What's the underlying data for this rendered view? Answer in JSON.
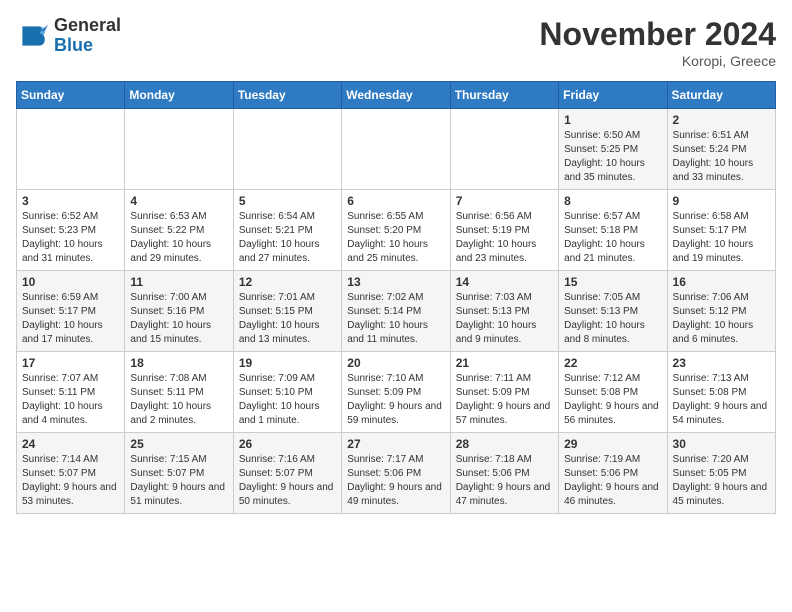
{
  "logo": {
    "general": "General",
    "blue": "Blue"
  },
  "title": "November 2024",
  "location": "Koropi, Greece",
  "days_header": [
    "Sunday",
    "Monday",
    "Tuesday",
    "Wednesday",
    "Thursday",
    "Friday",
    "Saturday"
  ],
  "weeks": [
    [
      {
        "day": "",
        "info": ""
      },
      {
        "day": "",
        "info": ""
      },
      {
        "day": "",
        "info": ""
      },
      {
        "day": "",
        "info": ""
      },
      {
        "day": "",
        "info": ""
      },
      {
        "day": "1",
        "info": "Sunrise: 6:50 AM\nSunset: 5:25 PM\nDaylight: 10 hours and 35 minutes."
      },
      {
        "day": "2",
        "info": "Sunrise: 6:51 AM\nSunset: 5:24 PM\nDaylight: 10 hours and 33 minutes."
      }
    ],
    [
      {
        "day": "3",
        "info": "Sunrise: 6:52 AM\nSunset: 5:23 PM\nDaylight: 10 hours and 31 minutes."
      },
      {
        "day": "4",
        "info": "Sunrise: 6:53 AM\nSunset: 5:22 PM\nDaylight: 10 hours and 29 minutes."
      },
      {
        "day": "5",
        "info": "Sunrise: 6:54 AM\nSunset: 5:21 PM\nDaylight: 10 hours and 27 minutes."
      },
      {
        "day": "6",
        "info": "Sunrise: 6:55 AM\nSunset: 5:20 PM\nDaylight: 10 hours and 25 minutes."
      },
      {
        "day": "7",
        "info": "Sunrise: 6:56 AM\nSunset: 5:19 PM\nDaylight: 10 hours and 23 minutes."
      },
      {
        "day": "8",
        "info": "Sunrise: 6:57 AM\nSunset: 5:18 PM\nDaylight: 10 hours and 21 minutes."
      },
      {
        "day": "9",
        "info": "Sunrise: 6:58 AM\nSunset: 5:17 PM\nDaylight: 10 hours and 19 minutes."
      }
    ],
    [
      {
        "day": "10",
        "info": "Sunrise: 6:59 AM\nSunset: 5:17 PM\nDaylight: 10 hours and 17 minutes."
      },
      {
        "day": "11",
        "info": "Sunrise: 7:00 AM\nSunset: 5:16 PM\nDaylight: 10 hours and 15 minutes."
      },
      {
        "day": "12",
        "info": "Sunrise: 7:01 AM\nSunset: 5:15 PM\nDaylight: 10 hours and 13 minutes."
      },
      {
        "day": "13",
        "info": "Sunrise: 7:02 AM\nSunset: 5:14 PM\nDaylight: 10 hours and 11 minutes."
      },
      {
        "day": "14",
        "info": "Sunrise: 7:03 AM\nSunset: 5:13 PM\nDaylight: 10 hours and 9 minutes."
      },
      {
        "day": "15",
        "info": "Sunrise: 7:05 AM\nSunset: 5:13 PM\nDaylight: 10 hours and 8 minutes."
      },
      {
        "day": "16",
        "info": "Sunrise: 7:06 AM\nSunset: 5:12 PM\nDaylight: 10 hours and 6 minutes."
      }
    ],
    [
      {
        "day": "17",
        "info": "Sunrise: 7:07 AM\nSunset: 5:11 PM\nDaylight: 10 hours and 4 minutes."
      },
      {
        "day": "18",
        "info": "Sunrise: 7:08 AM\nSunset: 5:11 PM\nDaylight: 10 hours and 2 minutes."
      },
      {
        "day": "19",
        "info": "Sunrise: 7:09 AM\nSunset: 5:10 PM\nDaylight: 10 hours and 1 minute."
      },
      {
        "day": "20",
        "info": "Sunrise: 7:10 AM\nSunset: 5:09 PM\nDaylight: 9 hours and 59 minutes."
      },
      {
        "day": "21",
        "info": "Sunrise: 7:11 AM\nSunset: 5:09 PM\nDaylight: 9 hours and 57 minutes."
      },
      {
        "day": "22",
        "info": "Sunrise: 7:12 AM\nSunset: 5:08 PM\nDaylight: 9 hours and 56 minutes."
      },
      {
        "day": "23",
        "info": "Sunrise: 7:13 AM\nSunset: 5:08 PM\nDaylight: 9 hours and 54 minutes."
      }
    ],
    [
      {
        "day": "24",
        "info": "Sunrise: 7:14 AM\nSunset: 5:07 PM\nDaylight: 9 hours and 53 minutes."
      },
      {
        "day": "25",
        "info": "Sunrise: 7:15 AM\nSunset: 5:07 PM\nDaylight: 9 hours and 51 minutes."
      },
      {
        "day": "26",
        "info": "Sunrise: 7:16 AM\nSunset: 5:07 PM\nDaylight: 9 hours and 50 minutes."
      },
      {
        "day": "27",
        "info": "Sunrise: 7:17 AM\nSunset: 5:06 PM\nDaylight: 9 hours and 49 minutes."
      },
      {
        "day": "28",
        "info": "Sunrise: 7:18 AM\nSunset: 5:06 PM\nDaylight: 9 hours and 47 minutes."
      },
      {
        "day": "29",
        "info": "Sunrise: 7:19 AM\nSunset: 5:06 PM\nDaylight: 9 hours and 46 minutes."
      },
      {
        "day": "30",
        "info": "Sunrise: 7:20 AM\nSunset: 5:05 PM\nDaylight: 9 hours and 45 minutes."
      }
    ]
  ]
}
